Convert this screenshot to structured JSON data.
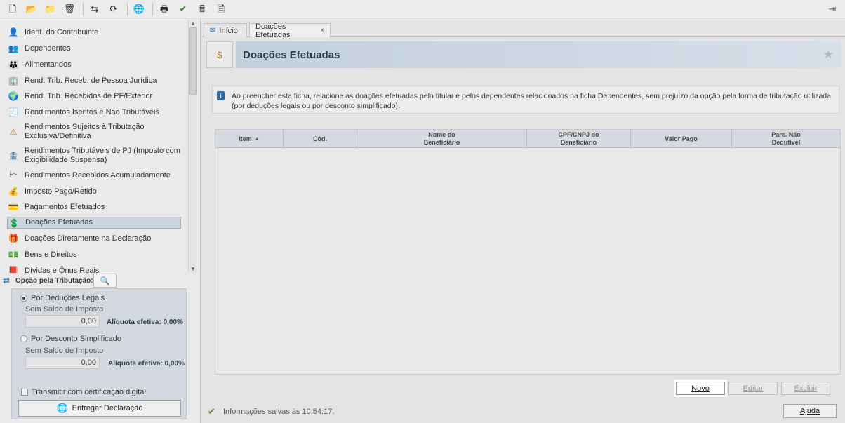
{
  "toolbar": {
    "icons": [
      {
        "name": "new-document-icon",
        "glyph": "🗋"
      },
      {
        "name": "open-folder-icon",
        "glyph": "📂"
      },
      {
        "name": "folder-icon",
        "glyph": "📁"
      },
      {
        "name": "trash-icon",
        "glyph": "🗑"
      },
      {
        "name": "import-icon",
        "glyph": "⇆"
      },
      {
        "name": "recover-icon",
        "glyph": "⟳"
      },
      {
        "name": "globe-icon",
        "glyph": "🌐"
      },
      {
        "name": "print-icon",
        "glyph": "🖶"
      },
      {
        "name": "check-icon",
        "glyph": "✔"
      },
      {
        "name": "calculator-icon",
        "glyph": "🖩"
      },
      {
        "name": "receipt-icon",
        "glyph": "🗎"
      }
    ],
    "exit_glyph": "⇥"
  },
  "nav": {
    "items": [
      {
        "label": "Ident. do Contribuinte",
        "icon": "person-icon",
        "glyph": "👤"
      },
      {
        "label": "Dependentes",
        "icon": "dependents-icon",
        "glyph": "👥"
      },
      {
        "label": "Alimentandos",
        "icon": "alimentandos-icon",
        "glyph": "👪"
      },
      {
        "label": "Rend. Trib. Receb. de Pessoa Jurídica",
        "icon": "company-income-icon",
        "glyph": "🏢"
      },
      {
        "label": "Rend. Trib. Recebidos de PF/Exterior",
        "icon": "pf-income-icon",
        "glyph": "🌍"
      },
      {
        "label": "Rendimentos Isentos e Não Tributáveis",
        "icon": "exempt-income-icon",
        "glyph": "🧾"
      },
      {
        "label": "Rendimentos Sujeitos à Tributação Exclusiva/Definitiva",
        "icon": "warning-icon",
        "glyph": "⚠"
      },
      {
        "label": "Rendimentos Tributáveis de PJ (Imposto com Exigibilidade Suspensa)",
        "icon": "suspended-tax-icon",
        "glyph": "🏦"
      },
      {
        "label": "Rendimentos Recebidos Acumuladamente",
        "icon": "accumulated-icon",
        "glyph": "🗠"
      },
      {
        "label": "Imposto Pago/Retido",
        "icon": "tax-paid-icon",
        "glyph": "💰"
      },
      {
        "label": "Pagamentos Efetuados",
        "icon": "payment-card-icon",
        "glyph": "💳"
      },
      {
        "label": "Doações Efetuadas",
        "icon": "donation-icon",
        "glyph": "💲"
      },
      {
        "label": "Doações Diretamente na Declaração",
        "icon": "direct-donation-icon",
        "glyph": "🎁"
      },
      {
        "label": "Bens e Direitos",
        "icon": "assets-icon",
        "glyph": "💵"
      },
      {
        "label": "Dívidas e Ônus Reais",
        "icon": "debts-icon",
        "glyph": "📕"
      }
    ],
    "selected_index": 11
  },
  "options": {
    "title": "Opção pela Tributação:",
    "zoom_glyph": "🔍",
    "legal": {
      "label": "Por Deduções Legais",
      "sub": "Sem Saldo de Imposto",
      "value": "0,00",
      "aliquota": "Alíquota efetiva: 0,00%"
    },
    "simplified": {
      "label": "Por Desconto Simplificado",
      "sub": "Sem Saldo de Imposto",
      "value": "0,00",
      "aliquota": "Alíquota efetiva: 0,00%"
    },
    "certificate_label": "Transmitir com certificação digital",
    "submit_label": "Entregar Declaração",
    "submit_glyph": "🌐"
  },
  "tabs": [
    {
      "label": "Início",
      "glyph": "✉"
    },
    {
      "label": "Doações Efetuadas",
      "close": "×"
    }
  ],
  "page": {
    "title": "Doações Efetuadas",
    "title_glyph": "$",
    "star_glyph": "★",
    "info_glyph": "i",
    "info_text": "Ao preencher esta ficha, relacione as doações efetuadas pelo titular e pelos dependentes relacionados na ficha Dependentes, sem prejuízo da opção pela forma de tributação utilizada (por deduções legais ou por desconto simplificado)."
  },
  "table": {
    "columns": [
      {
        "label": "Item",
        "sort": "▲"
      },
      {
        "label": "Cód."
      },
      {
        "label": "Nome do Beneficiário"
      },
      {
        "label": "CPF/CNPJ do Beneficiário"
      },
      {
        "label": "Valor Pago"
      },
      {
        "label": "Parc. Não Dedutível"
      }
    ],
    "rows": []
  },
  "actions": {
    "new": "Novo",
    "edit": "Editar",
    "delete": "Excluir",
    "help": "Ajuda"
  },
  "status": {
    "text": "Informações salvas às 10:54:17.",
    "glyph": "✔"
  }
}
